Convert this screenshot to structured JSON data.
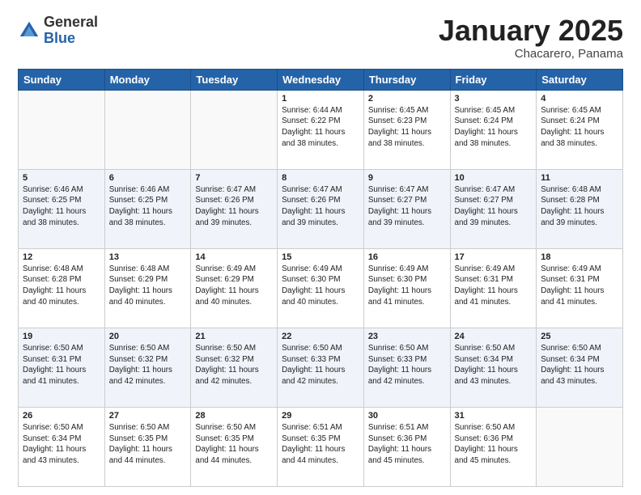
{
  "header": {
    "logo_general": "General",
    "logo_blue": "Blue",
    "month_title": "January 2025",
    "subtitle": "Chacarero, Panama"
  },
  "weekdays": [
    "Sunday",
    "Monday",
    "Tuesday",
    "Wednesday",
    "Thursday",
    "Friday",
    "Saturday"
  ],
  "weeks": [
    [
      {
        "day": "",
        "info": ""
      },
      {
        "day": "",
        "info": ""
      },
      {
        "day": "",
        "info": ""
      },
      {
        "day": "1",
        "info": "Sunrise: 6:44 AM\nSunset: 6:22 PM\nDaylight: 11 hours\nand 38 minutes."
      },
      {
        "day": "2",
        "info": "Sunrise: 6:45 AM\nSunset: 6:23 PM\nDaylight: 11 hours\nand 38 minutes."
      },
      {
        "day": "3",
        "info": "Sunrise: 6:45 AM\nSunset: 6:24 PM\nDaylight: 11 hours\nand 38 minutes."
      },
      {
        "day": "4",
        "info": "Sunrise: 6:45 AM\nSunset: 6:24 PM\nDaylight: 11 hours\nand 38 minutes."
      }
    ],
    [
      {
        "day": "5",
        "info": "Sunrise: 6:46 AM\nSunset: 6:25 PM\nDaylight: 11 hours\nand 38 minutes."
      },
      {
        "day": "6",
        "info": "Sunrise: 6:46 AM\nSunset: 6:25 PM\nDaylight: 11 hours\nand 38 minutes."
      },
      {
        "day": "7",
        "info": "Sunrise: 6:47 AM\nSunset: 6:26 PM\nDaylight: 11 hours\nand 39 minutes."
      },
      {
        "day": "8",
        "info": "Sunrise: 6:47 AM\nSunset: 6:26 PM\nDaylight: 11 hours\nand 39 minutes."
      },
      {
        "day": "9",
        "info": "Sunrise: 6:47 AM\nSunset: 6:27 PM\nDaylight: 11 hours\nand 39 minutes."
      },
      {
        "day": "10",
        "info": "Sunrise: 6:47 AM\nSunset: 6:27 PM\nDaylight: 11 hours\nand 39 minutes."
      },
      {
        "day": "11",
        "info": "Sunrise: 6:48 AM\nSunset: 6:28 PM\nDaylight: 11 hours\nand 39 minutes."
      }
    ],
    [
      {
        "day": "12",
        "info": "Sunrise: 6:48 AM\nSunset: 6:28 PM\nDaylight: 11 hours\nand 40 minutes."
      },
      {
        "day": "13",
        "info": "Sunrise: 6:48 AM\nSunset: 6:29 PM\nDaylight: 11 hours\nand 40 minutes."
      },
      {
        "day": "14",
        "info": "Sunrise: 6:49 AM\nSunset: 6:29 PM\nDaylight: 11 hours\nand 40 minutes."
      },
      {
        "day": "15",
        "info": "Sunrise: 6:49 AM\nSunset: 6:30 PM\nDaylight: 11 hours\nand 40 minutes."
      },
      {
        "day": "16",
        "info": "Sunrise: 6:49 AM\nSunset: 6:30 PM\nDaylight: 11 hours\nand 41 minutes."
      },
      {
        "day": "17",
        "info": "Sunrise: 6:49 AM\nSunset: 6:31 PM\nDaylight: 11 hours\nand 41 minutes."
      },
      {
        "day": "18",
        "info": "Sunrise: 6:49 AM\nSunset: 6:31 PM\nDaylight: 11 hours\nand 41 minutes."
      }
    ],
    [
      {
        "day": "19",
        "info": "Sunrise: 6:50 AM\nSunset: 6:31 PM\nDaylight: 11 hours\nand 41 minutes."
      },
      {
        "day": "20",
        "info": "Sunrise: 6:50 AM\nSunset: 6:32 PM\nDaylight: 11 hours\nand 42 minutes."
      },
      {
        "day": "21",
        "info": "Sunrise: 6:50 AM\nSunset: 6:32 PM\nDaylight: 11 hours\nand 42 minutes."
      },
      {
        "day": "22",
        "info": "Sunrise: 6:50 AM\nSunset: 6:33 PM\nDaylight: 11 hours\nand 42 minutes."
      },
      {
        "day": "23",
        "info": "Sunrise: 6:50 AM\nSunset: 6:33 PM\nDaylight: 11 hours\nand 42 minutes."
      },
      {
        "day": "24",
        "info": "Sunrise: 6:50 AM\nSunset: 6:34 PM\nDaylight: 11 hours\nand 43 minutes."
      },
      {
        "day": "25",
        "info": "Sunrise: 6:50 AM\nSunset: 6:34 PM\nDaylight: 11 hours\nand 43 minutes."
      }
    ],
    [
      {
        "day": "26",
        "info": "Sunrise: 6:50 AM\nSunset: 6:34 PM\nDaylight: 11 hours\nand 43 minutes."
      },
      {
        "day": "27",
        "info": "Sunrise: 6:50 AM\nSunset: 6:35 PM\nDaylight: 11 hours\nand 44 minutes."
      },
      {
        "day": "28",
        "info": "Sunrise: 6:50 AM\nSunset: 6:35 PM\nDaylight: 11 hours\nand 44 minutes."
      },
      {
        "day": "29",
        "info": "Sunrise: 6:51 AM\nSunset: 6:35 PM\nDaylight: 11 hours\nand 44 minutes."
      },
      {
        "day": "30",
        "info": "Sunrise: 6:51 AM\nSunset: 6:36 PM\nDaylight: 11 hours\nand 45 minutes."
      },
      {
        "day": "31",
        "info": "Sunrise: 6:50 AM\nSunset: 6:36 PM\nDaylight: 11 hours\nand 45 minutes."
      },
      {
        "day": "",
        "info": ""
      }
    ]
  ]
}
